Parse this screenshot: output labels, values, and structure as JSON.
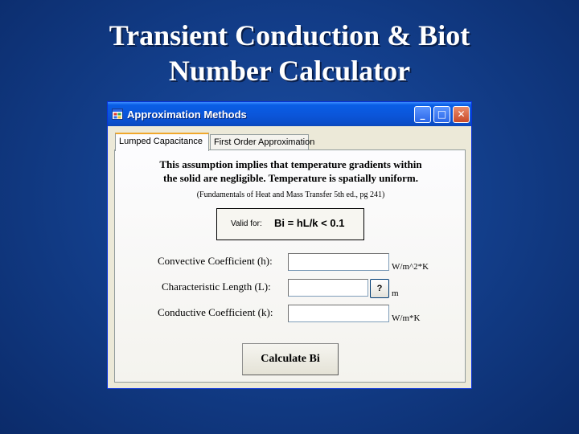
{
  "slide": {
    "title_line1": "Transient Conduction & Biot",
    "title_line2": "Number Calculator"
  },
  "window": {
    "title": "Approximation Methods",
    "minimize_glyph": "_",
    "maximize_glyph": "□",
    "close_glyph": "✕"
  },
  "tabs": [
    {
      "label": "Lumped Capacitance",
      "active": true
    },
    {
      "label": "First Order Approximation",
      "active": false
    }
  ],
  "panel": {
    "description_line1": "This assumption implies that temperature gradients within",
    "description_line2": "the solid are negligible.  Temperature is spatially uniform.",
    "reference": "(Fundamentals of Heat and Mass Transfer 5th ed., pg 241)",
    "valid_label": "Valid for:",
    "valid_condition": "Bi = hL/k < 0.1"
  },
  "fields": {
    "convective": {
      "label": "Convective Coefficient (h):",
      "value": "",
      "unit": "W/m^2*K"
    },
    "length": {
      "label": "Characteristic Length (L):",
      "value": "",
      "unit": "m",
      "help_label": "?"
    },
    "conductive": {
      "label": "Conductive Coefficient (k):",
      "value": "",
      "unit": "W/m*K"
    }
  },
  "calculate_button": "Calculate Bi",
  "colors": {
    "slide_background": "#133f8c",
    "titlebar": "#0b55d9",
    "window_face": "#ece9d8",
    "active_tab_accent": "#f0a82c"
  },
  "icons": {
    "app": "window-app-icon",
    "minimize": "minimize-icon",
    "maximize": "maximize-icon",
    "close": "close-icon"
  }
}
